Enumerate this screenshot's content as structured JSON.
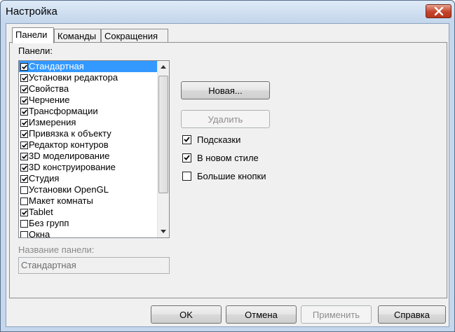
{
  "window": {
    "title": "Настройка"
  },
  "tabs": [
    "Панели",
    "Команды",
    "Сокращения"
  ],
  "panels_label": "Панели:",
  "panels_list": [
    {
      "label": "Стандартная",
      "checked": true,
      "selected": true
    },
    {
      "label": "Установки редактора",
      "checked": true
    },
    {
      "label": "Свойства",
      "checked": true
    },
    {
      "label": "Черчение",
      "checked": true
    },
    {
      "label": "Трансформации",
      "checked": true
    },
    {
      "label": "Измерения",
      "checked": true
    },
    {
      "label": "Привязка к объекту",
      "checked": true
    },
    {
      "label": "Редактор контуров",
      "checked": true
    },
    {
      "label": "3D моделирование",
      "checked": true
    },
    {
      "label": "3D конструирование",
      "checked": true
    },
    {
      "label": "Студия",
      "checked": true
    },
    {
      "label": "Установки OpenGL",
      "checked": false
    },
    {
      "label": "Макет комнаты",
      "checked": false
    },
    {
      "label": "Tablet",
      "checked": true
    },
    {
      "label": "Без групп",
      "checked": false
    },
    {
      "label": "Окна",
      "checked": false
    }
  ],
  "buttons": {
    "new": "Новая...",
    "delete": "Удалить"
  },
  "options": [
    {
      "label": "Подсказки",
      "checked": true
    },
    {
      "label": "В новом стиле",
      "checked": true
    },
    {
      "label": "Большие кнопки",
      "checked": false
    }
  ],
  "panel_name": {
    "label": "Название панели:",
    "value": "Стандартная"
  },
  "footer": {
    "ok": "OK",
    "cancel": "Отмена",
    "apply": "Применить",
    "help": "Справка"
  },
  "colors": {
    "selection": "#3399ff",
    "close_button": "#c4432a",
    "disabled_text": "#8d8d8d"
  },
  "icons": {
    "close": "close-icon",
    "checkmark": "checkmark-icon",
    "scroll_up": "arrow-up-icon",
    "scroll_down": "arrow-down-icon"
  }
}
